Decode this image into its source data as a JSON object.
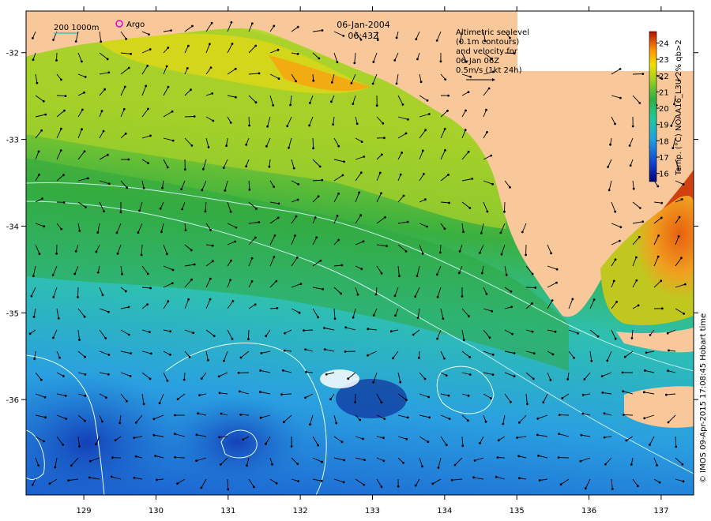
{
  "header": {
    "date": "06-Jan-2004",
    "time": "06:43Z",
    "depth_legend": "200  1000m",
    "argo_label": "Argo"
  },
  "velocity_note": {
    "lines": [
      "Altimetric sealevel",
      "(0.1m contours)",
      "and velocity for",
      "06-Jan 06Z",
      "0.5m/s (1kt 24h)"
    ]
  },
  "colorbar": {
    "title": "Temp. (°C) NOAA16_L3U 2% qb>2",
    "ticks": [
      "24",
      "23",
      "22",
      "21",
      "20",
      "19",
      "18",
      "17",
      "16"
    ],
    "min": 15.5,
    "max": 24.7
  },
  "axes": {
    "lon_ticks": [
      "129",
      "130",
      "131",
      "132",
      "133",
      "134",
      "135",
      "136",
      "137"
    ],
    "lat_ticks": [
      "-32",
      "-33",
      "-34",
      "-35",
      "-36"
    ]
  },
  "credit": "© IMOS 09-Apr-2015 17:08:45 Hobart time",
  "colors": {
    "land": "#f8c89a",
    "warm": "#ff8000",
    "cool": "#1050c0"
  }
}
